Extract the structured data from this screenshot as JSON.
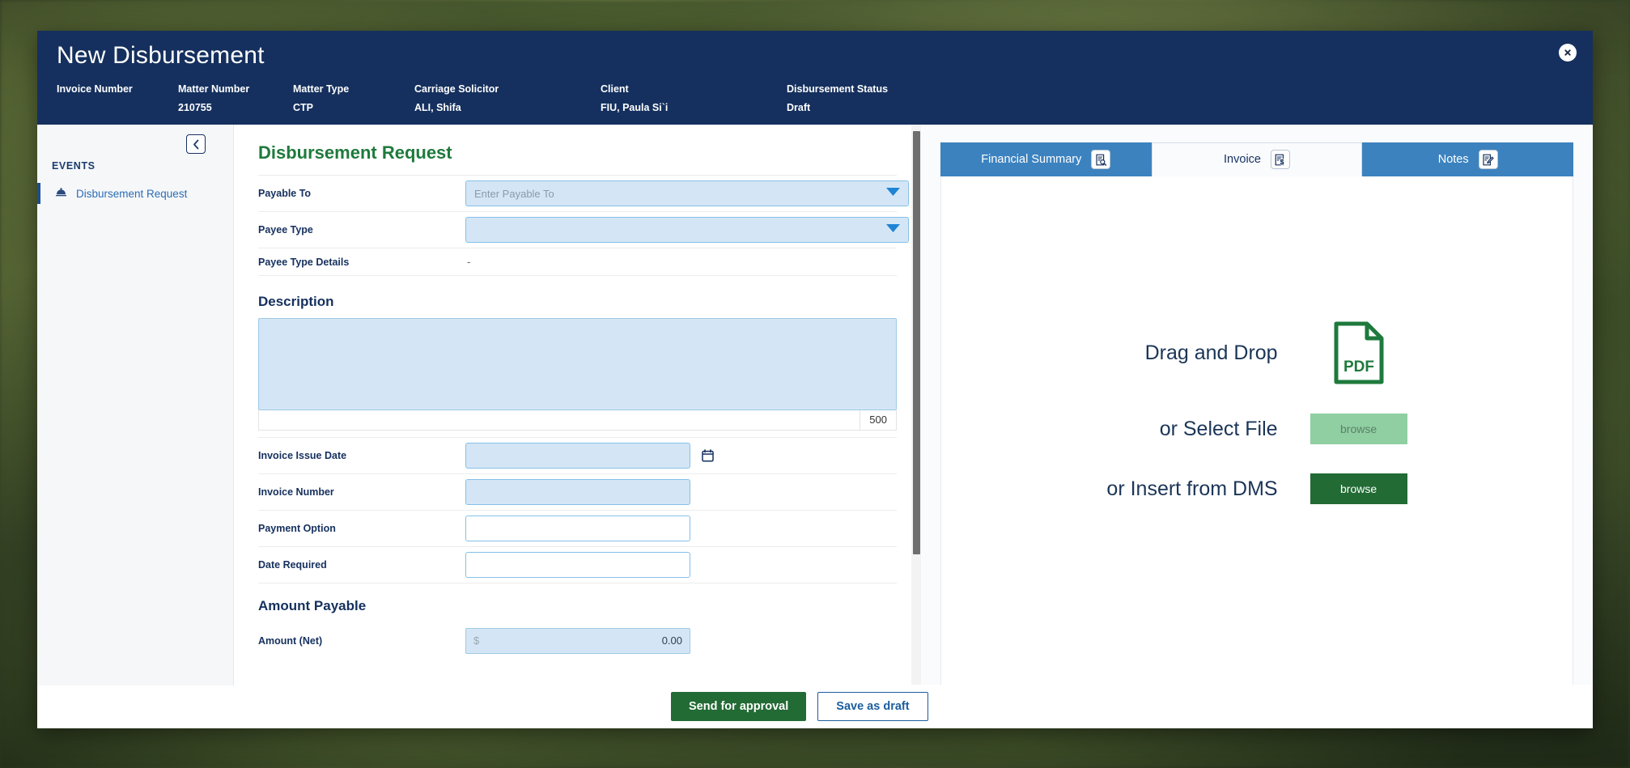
{
  "window": {
    "title": "New Disbursement",
    "close_icon": "close-circle-icon"
  },
  "meta": [
    {
      "label": "Invoice Number",
      "value": ""
    },
    {
      "label": "Matter Number",
      "value": "210755"
    },
    {
      "label": "Matter Type",
      "value": "CTP"
    },
    {
      "label": "Carriage Solicitor",
      "value": "ALI, Shifa"
    },
    {
      "label": "Client",
      "value": "FIU, Paula Si`i"
    },
    {
      "label": "Disbursement Status",
      "value": "Draft"
    }
  ],
  "sidebar": {
    "collapse_icon": "chevron-left-icon",
    "heading": "EVENTS",
    "items": [
      {
        "label": "Disbursement Request",
        "icon": "service-bell-icon"
      }
    ]
  },
  "form": {
    "title": "Disbursement Request",
    "payable_to": {
      "label": "Payable To",
      "value": "",
      "placeholder": "Enter Payable To",
      "caret_icon": "chevron-down-icon"
    },
    "payee_type": {
      "label": "Payee Type",
      "value": "",
      "placeholder": "",
      "caret_icon": "chevron-down-icon"
    },
    "payee_type_details": {
      "label": "Payee Type Details",
      "value": "-"
    },
    "description": {
      "heading": "Description",
      "value": "",
      "placeholder": "",
      "counter": "500"
    },
    "invoice_issue_date": {
      "label": "Invoice Issue Date",
      "value": "",
      "placeholder": "",
      "icon": "calendar-icon"
    },
    "invoice_number": {
      "label": "Invoice Number",
      "value": "",
      "placeholder": ""
    },
    "payment_option": {
      "label": "Payment Option",
      "value": "",
      "placeholder": ""
    },
    "date_required": {
      "label": "Date Required",
      "value": "",
      "placeholder": ""
    },
    "amount_payable": {
      "heading": "Amount Payable",
      "net": {
        "label": "Amount (Net)",
        "currency": "$",
        "value": "0.00"
      }
    }
  },
  "actions": {
    "send_for_approval": "Send for approval",
    "save_as_draft": "Save as draft"
  },
  "right_panel": {
    "tabs": [
      {
        "label": "Financial Summary",
        "icon": "document-search-icon",
        "active": false
      },
      {
        "label": "Invoice",
        "icon": "document-dollar-icon",
        "active": true
      },
      {
        "label": "Notes",
        "icon": "document-pen-icon",
        "active": false
      }
    ],
    "dropzone": {
      "drag_text": "Drag and Drop",
      "file_icon": "pdf-file-icon",
      "file_icon_label": "PDF",
      "select_text": "or Select File",
      "select_button": "browse",
      "dms_text": "or Insert from DMS",
      "dms_button": "browse"
    }
  },
  "colors": {
    "header_navy": "#15305e",
    "tab_blue": "#3c82bf",
    "primary_green": "#226b34",
    "section_green": "#1e7a3c",
    "field_fill": "#d4e6f5"
  }
}
